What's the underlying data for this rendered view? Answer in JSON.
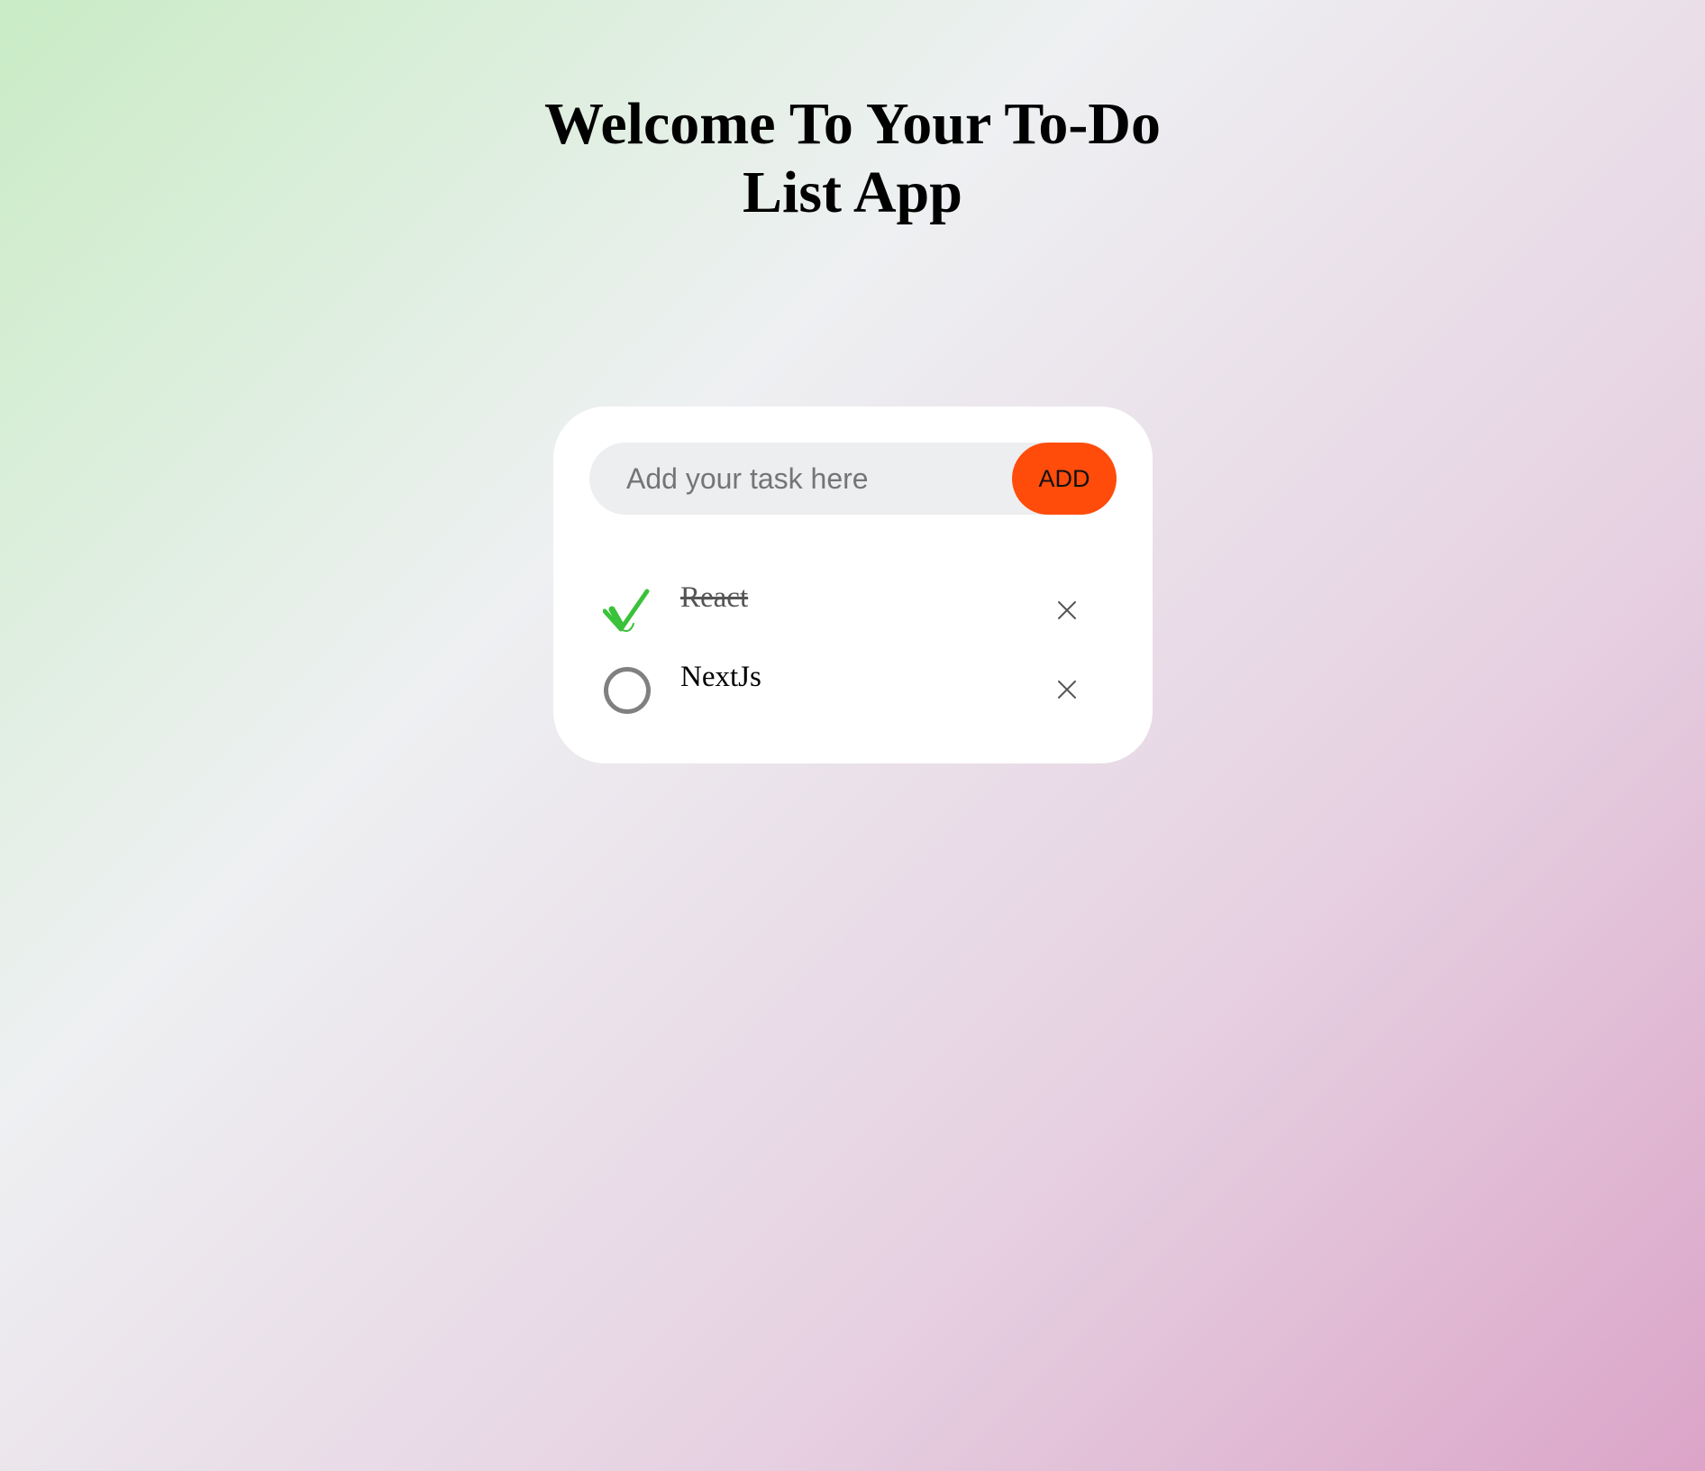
{
  "header": {
    "title_line1": "Welcome To Your To-Do",
    "title_line2": "List App"
  },
  "form": {
    "placeholder": "Add your task here",
    "value": "",
    "add_label": "ADD"
  },
  "tasks": [
    {
      "label": "React",
      "completed": true,
      "status_icon": "checkmark-icon",
      "delete_icon": "close-icon"
    },
    {
      "label": "NextJs",
      "completed": false,
      "status_icon": "empty-circle-icon",
      "delete_icon": "close-icon"
    }
  ],
  "colors": {
    "accent": "#ff4c0b",
    "check": "#3ac23a",
    "circle": "#808080",
    "input_bg": "#edeef0",
    "gradient_start": "#c9ecc5",
    "gradient_end": "#dba4c8"
  }
}
